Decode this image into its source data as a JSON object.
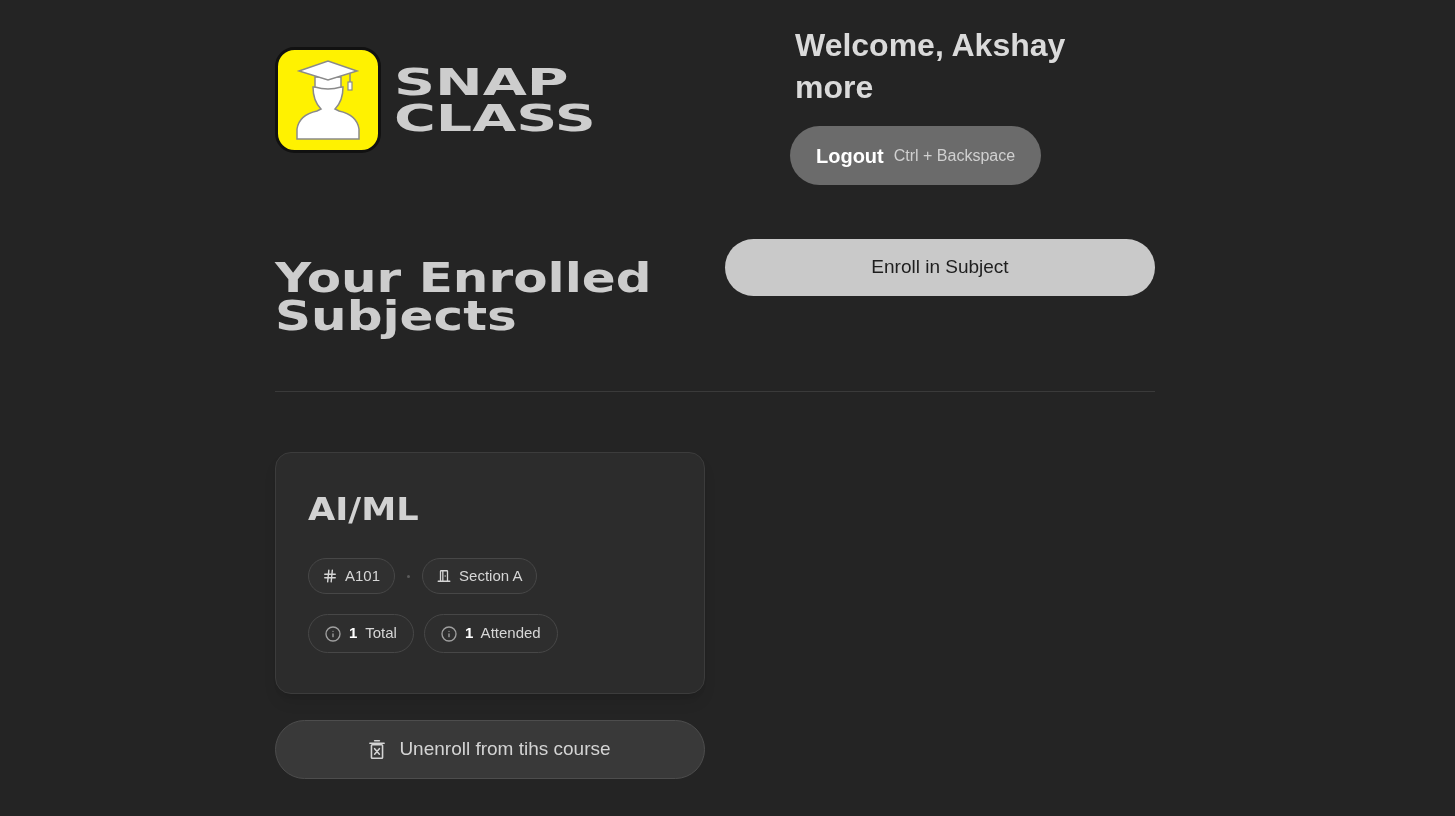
{
  "brand": {
    "title": "SNAP CLASS"
  },
  "welcome": {
    "text": "Welcome, Akshay more"
  },
  "logout_button": {
    "label": "Logout",
    "shortcut": "Ctrl + Backspace"
  },
  "heading": "Your Enrolled Subjects",
  "enroll_button": {
    "label": "Enroll in Subject"
  },
  "subjects": [
    {
      "title": "AI/ML",
      "code": "A101",
      "section": "Section A",
      "stats": [
        {
          "text": "**1** Total"
        },
        {
          "text": "**1** Attended"
        }
      ],
      "unenroll_button": {
        "label": "Unenroll from tihs course"
      }
    }
  ]
}
